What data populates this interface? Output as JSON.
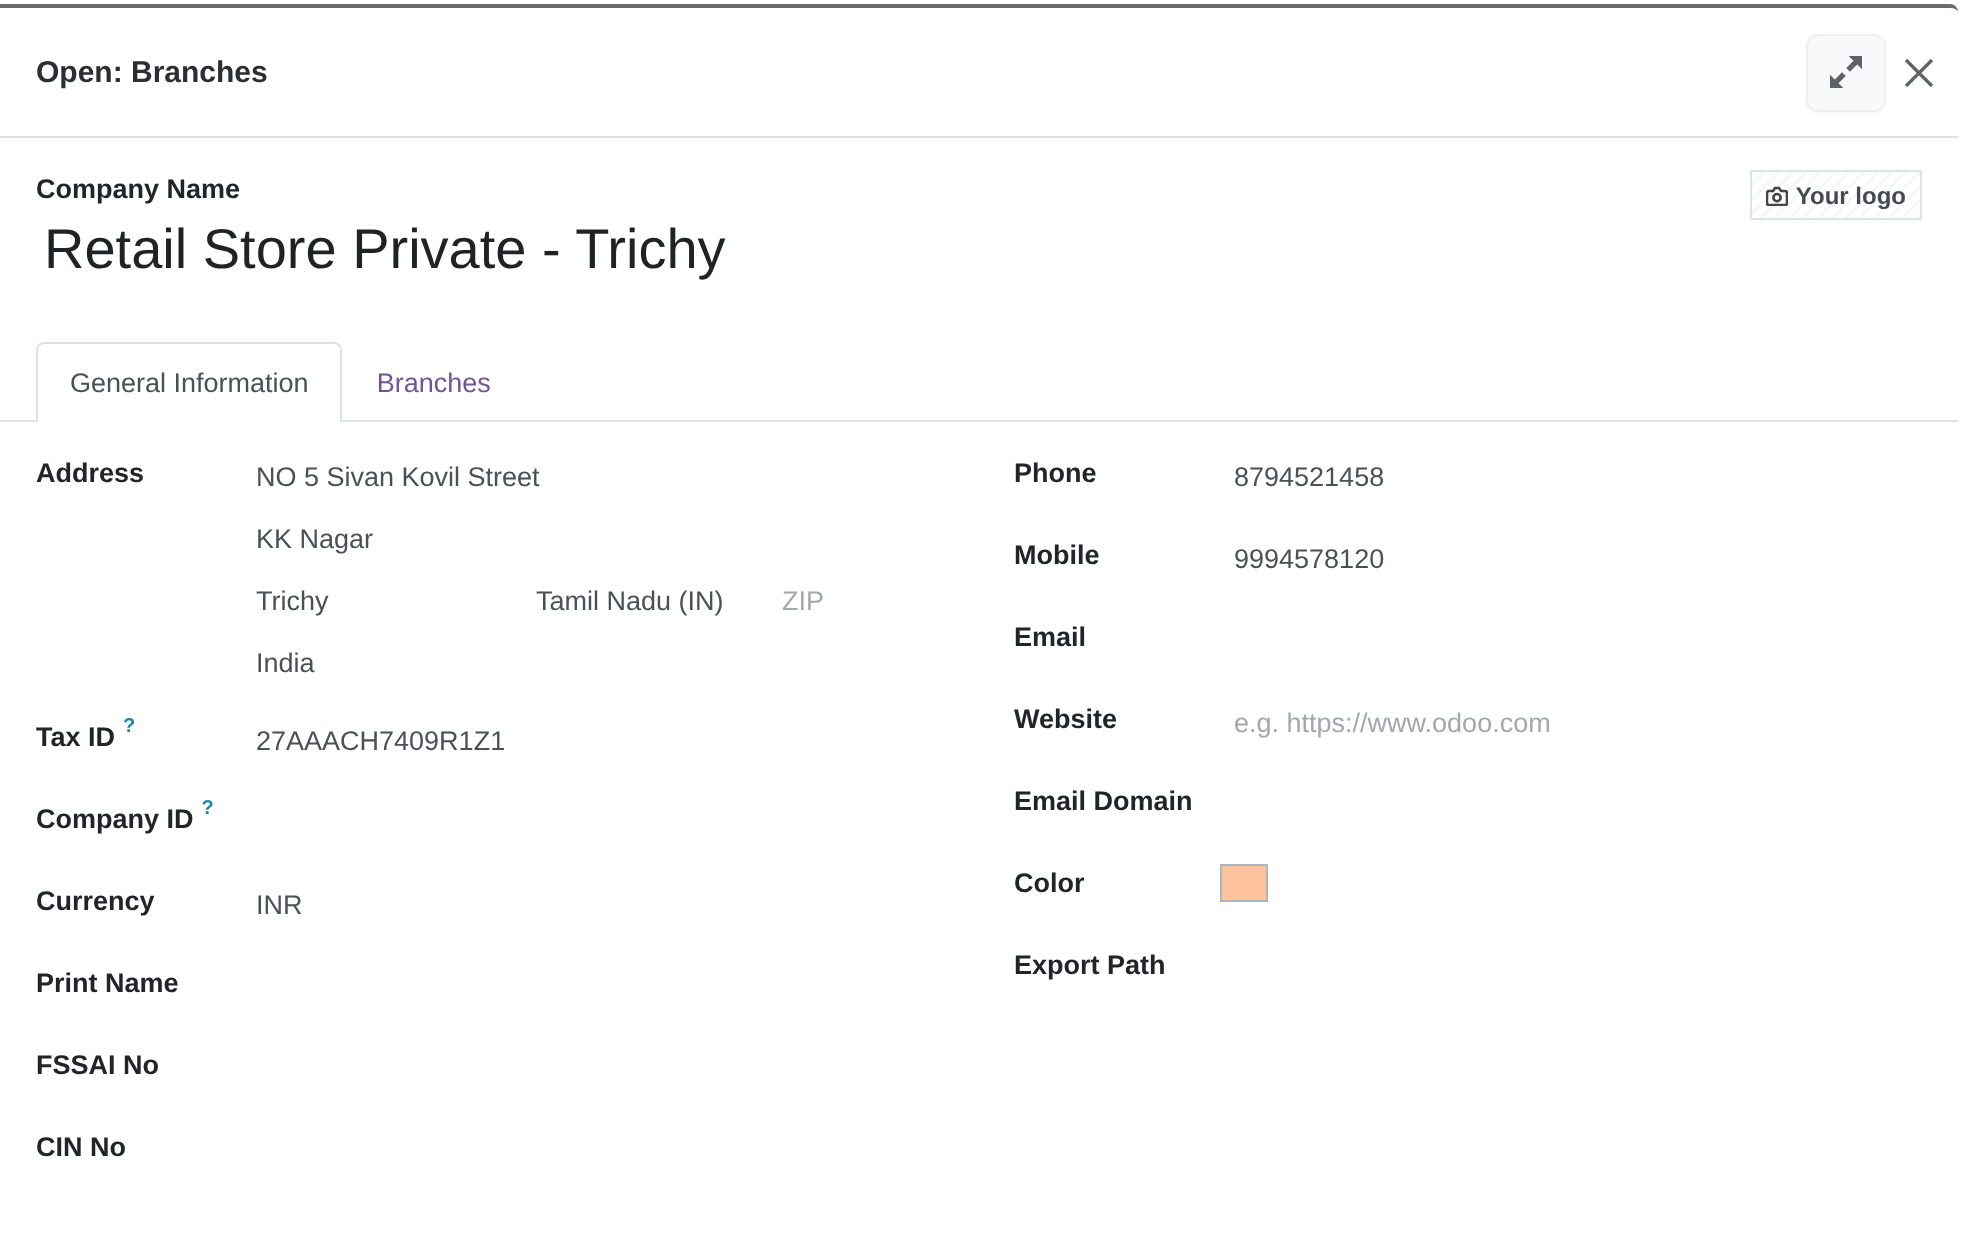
{
  "dialog": {
    "title": "Open: Branches"
  },
  "company": {
    "label": "Company Name",
    "name": "Retail Store Private - Trichy",
    "logo_button": "Your logo"
  },
  "tabs": [
    {
      "label": "General Information",
      "selected": true
    },
    {
      "label": "Branches",
      "selected": false
    }
  ],
  "left_fields": [
    {
      "kind": "address",
      "label": "Address",
      "street": "NO 5 Sivan Kovil Street",
      "street2": "KK Nagar",
      "city": "Trichy",
      "state": "Tamil Nadu (IN)",
      "zip": {
        "placeholder": "ZIP"
      },
      "country": "India"
    },
    {
      "kind": "text",
      "label": "Tax ID",
      "help": "?",
      "value": "27AAACH7409R1Z1"
    },
    {
      "kind": "text",
      "label": "Company ID",
      "help": "?"
    },
    {
      "kind": "text",
      "label": "Currency",
      "value": "INR"
    },
    {
      "kind": "text",
      "label": "Print Name"
    },
    {
      "kind": "text",
      "label": "FSSAI No"
    },
    {
      "kind": "text",
      "label": "CIN No"
    }
  ],
  "right_fields": [
    {
      "kind": "text",
      "label": "Phone",
      "value": "8794521458"
    },
    {
      "kind": "text",
      "label": "Mobile",
      "value": "9994578120"
    },
    {
      "kind": "text",
      "label": "Email"
    },
    {
      "kind": "text",
      "label": "Website",
      "placeholder": "e.g. https://www.odoo.com"
    },
    {
      "kind": "text",
      "label": "Email Domain"
    },
    {
      "kind": "color",
      "label": "Color",
      "color": "#ffc49b"
    },
    {
      "kind": "text",
      "label": "Export Path"
    }
  ]
}
